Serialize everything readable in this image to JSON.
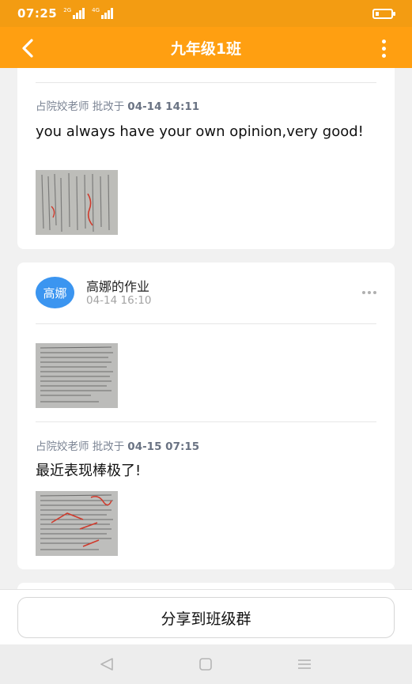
{
  "status_bar": {
    "time": "07:25",
    "network_1": "2G",
    "network_2": "4G"
  },
  "nav": {
    "title": "九年级1班"
  },
  "card1": {
    "teacher": "占院姣老师 批改于",
    "time": "04-14 14:11",
    "comment": "you always have your own opinion,very good!"
  },
  "card2": {
    "avatar_text": "高娜",
    "title": "高娜的作业",
    "time": "04-14 16:10",
    "teacher": "占院姣老师 批改于",
    "review_time": "04-15 07:15",
    "comment": "最近表现棒极了!"
  },
  "share": {
    "label": "分享到班级群"
  },
  "colors": {
    "brand": "#ff9f11",
    "avatar": "#3b95f0"
  }
}
